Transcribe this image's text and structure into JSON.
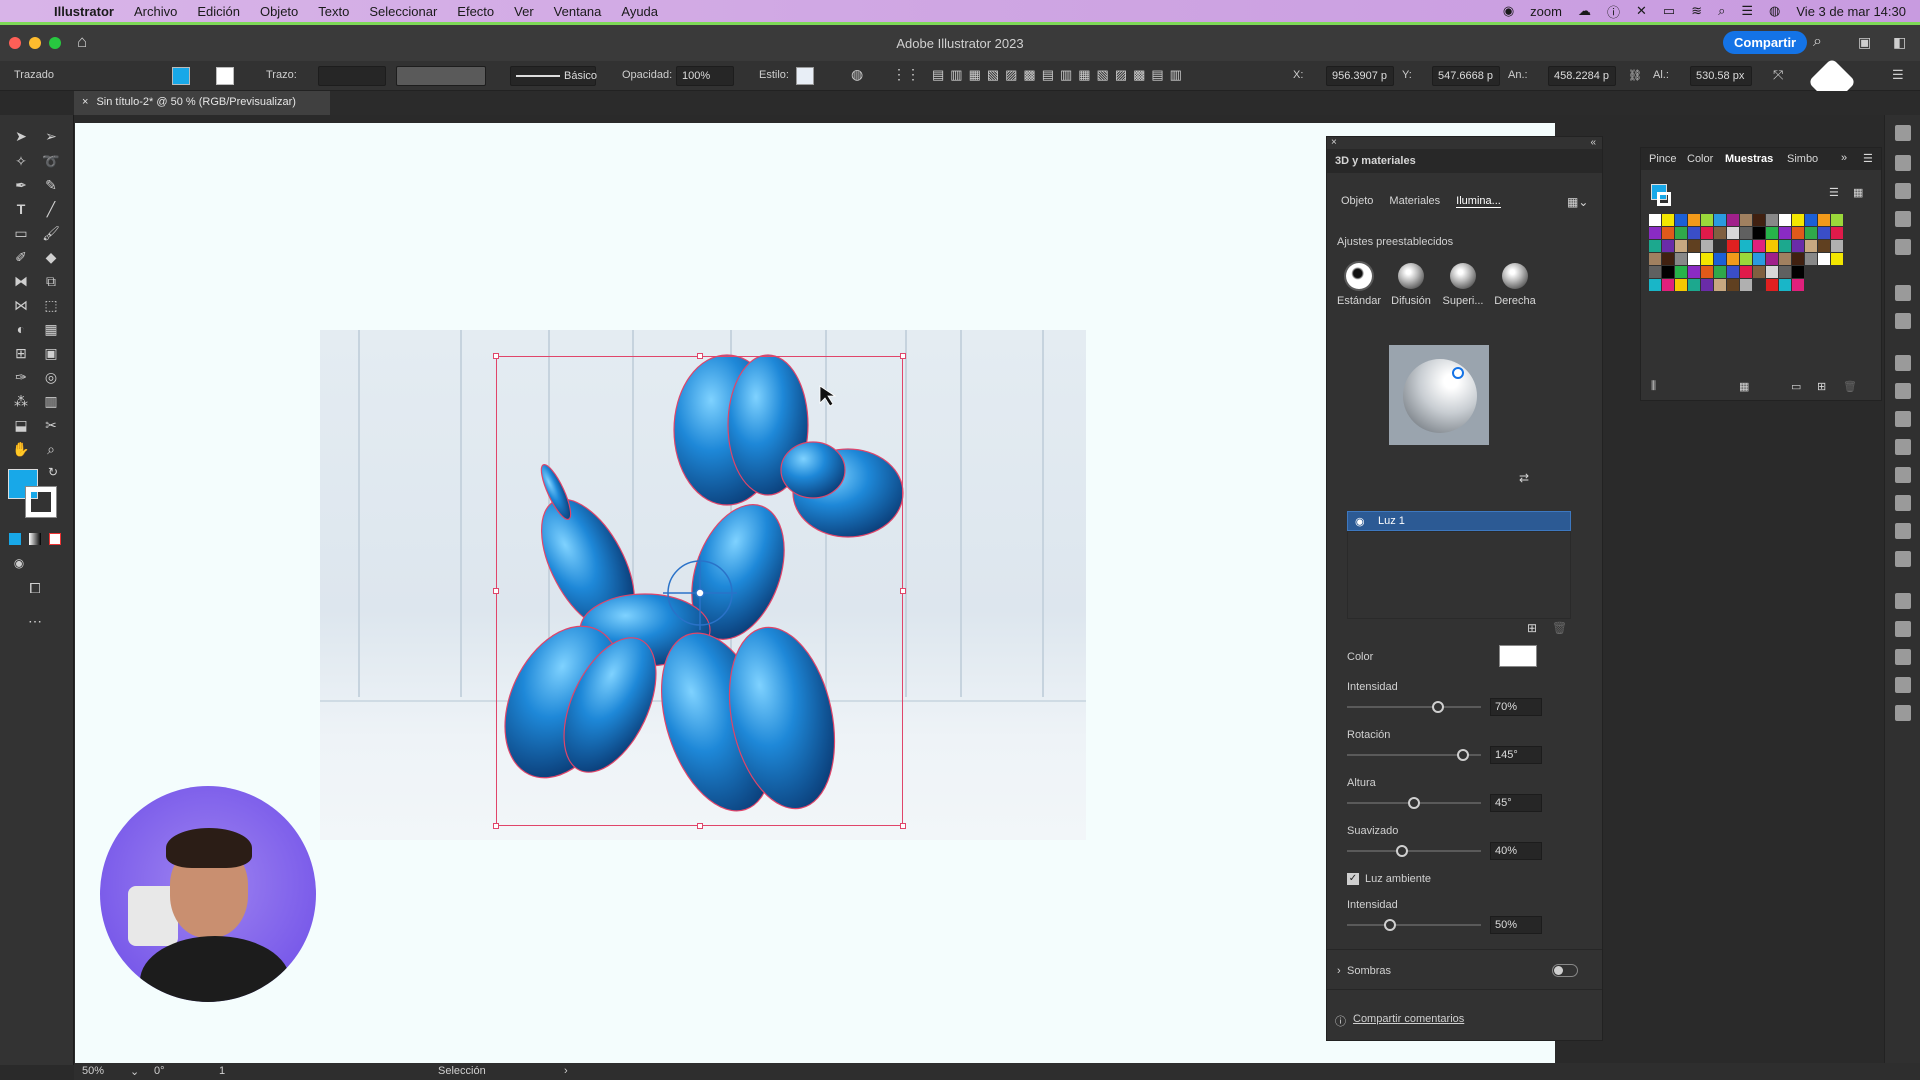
{
  "menubar": {
    "app": "Illustrator",
    "items": [
      "Archivo",
      "Edición",
      "Objeto",
      "Texto",
      "Seleccionar",
      "Efecto",
      "Ver",
      "Ventana",
      "Ayuda"
    ],
    "zoom_label": "zoom",
    "datetime": "Vie 3 de mar  14:30"
  },
  "window": {
    "title": "Adobe Illustrator 2023",
    "share_label": "Compartir"
  },
  "controlbar": {
    "selection_label": "Trazado",
    "stroke_label": "Trazo:",
    "brush_label": "Básico",
    "opacity_label": "Opacidad:",
    "opacity_value": "100%",
    "style_label": "Estilo:",
    "x_label": "X:",
    "x_value": "956.3907 p",
    "y_label": "Y:",
    "y_value": "547.6668 p",
    "w_label": "An.:",
    "w_value": "458.2284 p",
    "h_label": "Al.:",
    "h_value": "530.58 px"
  },
  "document": {
    "tab_title": "Sin título-2* @ 50 % (RGB/Previsualizar)"
  },
  "panel3d": {
    "title": "3D y materiales",
    "tabs": [
      "Objeto",
      "Materiales",
      "Ilumina..."
    ],
    "presets_label": "Ajustes preestablecidos",
    "presets": [
      "Estándar",
      "Difusión",
      "Superi...",
      "Derecha"
    ],
    "light_name": "Luz 1",
    "color_label": "Color",
    "intensity_label": "Intensidad",
    "intensity_value": "70%",
    "intensity_level": 0.7,
    "rotation_label": "Rotación",
    "rotation_value": "145°",
    "rotation_level": 0.9,
    "height_label": "Altura",
    "height_value": "45°",
    "height_level": 0.5,
    "softness_label": "Suavizado",
    "softness_value": "40%",
    "softness_level": 0.4,
    "ambient_label": "Luz ambiente",
    "ambient_intensity_label": "Intensidad",
    "ambient_intensity_value": "50%",
    "ambient_level": 0.3,
    "shadows_label": "Sombras",
    "feedback_label": "Compartir comentarios"
  },
  "swatches_panel": {
    "tabs": [
      "Pince",
      "Color",
      "Muestras",
      "Simbo"
    ]
  },
  "statusbar": {
    "zoom": "50%",
    "rotation": "0°",
    "artboard": "1",
    "tool": "Selección"
  },
  "colors": {
    "fill": "#18a8e8",
    "accent": "#1473e6",
    "selection": "#e0456a",
    "balloon": "#1e88d8"
  }
}
